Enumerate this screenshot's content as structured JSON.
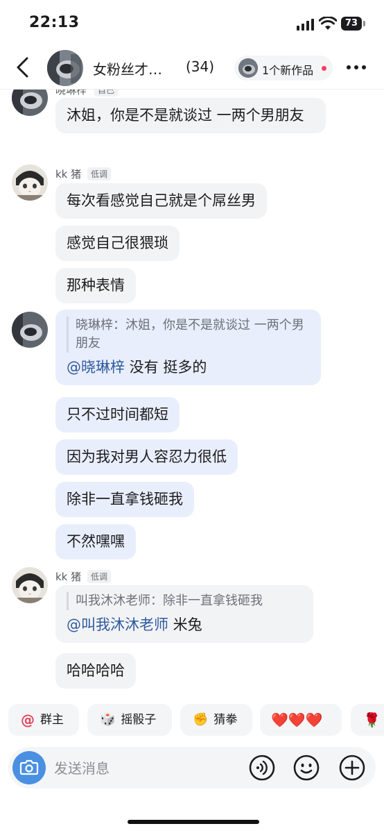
{
  "status_bar": {
    "time": "22:13",
    "battery": "73"
  },
  "header": {
    "title": "女粉丝才…",
    "member_count": "(34)",
    "new_work": "1个新作品"
  },
  "messages": [
    {
      "sender": "晓琳梓",
      "badge": "自己",
      "bubbles": [
        "沐姐，你是不是就谈过 一两个男朋友"
      ]
    },
    {
      "sender": "kk 猪",
      "badge": "低调",
      "bubbles": [
        "每次看感觉自己就是个屌丝男",
        "感觉自己很猥琐",
        "那种表情"
      ]
    },
    {
      "quote": {
        "author": "晓琳梓",
        "text": "晓琳梓：沐姐，你是不是就谈过 一两个男朋友",
        "mention": "@晓琳梓",
        "reply": " 没有 挺多的"
      },
      "bubbles": [
        "只不过时间都短",
        "因为我对男人容忍力很低",
        "除非一直拿钱砸我",
        "不然嘿嘿"
      ]
    },
    {
      "sender": "kk 猪",
      "badge": "低调",
      "quote": {
        "text": "叫我沐沐老师：除非一直拿钱砸我",
        "mention": "@叫我沐沐老师",
        "reply": " 米兔"
      },
      "bubbles": [
        "哈哈哈哈"
      ]
    }
  ],
  "quick_replies": [
    {
      "icon": "at-icon",
      "icon_char": "@",
      "label": "群主"
    },
    {
      "icon": "dice-icon",
      "icon_char": "🎲",
      "label": "摇骰子"
    },
    {
      "icon": "fist-icon",
      "icon_char": "✊",
      "label": "猜拳"
    },
    {
      "icon": "heart-icon",
      "label": "❤️❤️❤️"
    },
    {
      "icon": "rose-icon",
      "icon_char": "🌹",
      "label": ""
    }
  ],
  "input": {
    "placeholder": "发送消息"
  },
  "colors": {
    "accent_blue": "#4a90e2",
    "mention": "#2f5a9e",
    "self_bubble": "#e9eefc",
    "other_bubble": "#f2f3f5",
    "notification_dot": "#ff3b5c"
  }
}
